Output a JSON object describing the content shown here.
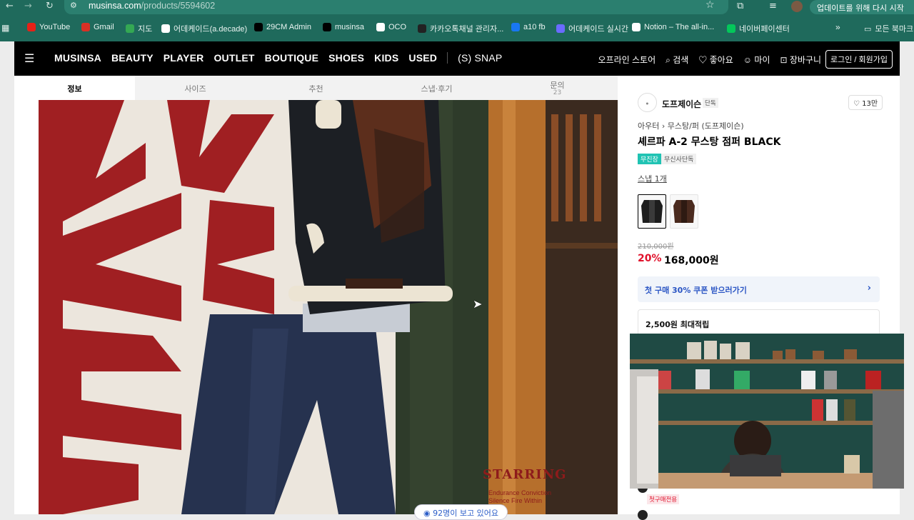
{
  "browser": {
    "url_host": "musinsa.com",
    "url_path": "/products/5594602",
    "update_label": "업데이트를 위해 다시 시작"
  },
  "bookmarks": [
    {
      "label": "YouTube",
      "icon": "youtube-icon",
      "color": "#e62117"
    },
    {
      "label": "Gmail",
      "icon": "gmail-icon",
      "color": "#d93025"
    },
    {
      "label": "지도",
      "icon": "maps-icon",
      "color": "#34a853"
    },
    {
      "label": "어데케이드(a.decade)",
      "icon": "globe-icon",
      "color": "#ffffff"
    },
    {
      "label": "29CM Admin",
      "icon": "29cm-icon",
      "color": "#000000"
    },
    {
      "label": "musinsa",
      "icon": "musinsa-icon",
      "color": "#000000"
    },
    {
      "label": "OCO",
      "icon": "globe-icon",
      "color": "#ffffff"
    },
    {
      "label": "카카오톡채널 관리자...",
      "icon": "kakao-icon",
      "color": "#222222"
    },
    {
      "label": "a10 fb",
      "icon": "facebook-icon",
      "color": "#1877f2"
    },
    {
      "label": "어데케이드 실시간",
      "icon": "chat-icon",
      "color": "#6b6bff"
    },
    {
      "label": "Notion – The all-in...",
      "icon": "notion-icon",
      "color": "#ffffff"
    },
    {
      "label": "네이버페이센터",
      "icon": "naverpay-icon",
      "color": "#03c75a"
    }
  ],
  "bookmarks_folder": "모든 북마크",
  "header": {
    "nav": [
      "MUSINSA",
      "BEAUTY",
      "PLAYER",
      "OUTLET",
      "BOUTIQUE",
      "SHOES",
      "KIDS",
      "USED"
    ],
    "snap": "(S) SNAP",
    "util": [
      "오프라인 스토어",
      "검색",
      "좋아요",
      "마이",
      "장바구니"
    ],
    "login": "로그인 / 회원가입"
  },
  "tabs": [
    {
      "label": "정보",
      "active": true
    },
    {
      "label": "사이즈"
    },
    {
      "label": "추천"
    },
    {
      "label": "스냅·후기"
    },
    {
      "label": "문의",
      "count": "23"
    }
  ],
  "image": {
    "starring": "STARRING",
    "starring_sub1": "Endurance Conviction",
    "starring_sub2": "Silence Fire Within",
    "viewers": "92명이 보고 있어요"
  },
  "product": {
    "brand": "도프제이슨",
    "brand_tag": "단독",
    "likes": "13만",
    "category": "아우터",
    "subcategory": "무스탕/퍼 (도프제이슨)",
    "title": "셰르파 A-2 무스탕 점퍼 BLACK",
    "badge_1": "무진장",
    "badge_2": "무신사단독",
    "snap_link": "스냅 1개",
    "original_price": "210,000원",
    "discount": "20%",
    "sale_price": "168,000원",
    "coupon": "첫 구매 30% 쿠폰 받으러가기",
    "points": "2,500원 최대적립",
    "bottom_tag": "첫구매전용"
  },
  "colors": {
    "chrome": "#1f6a5c",
    "sale_red": "#e0112b",
    "link_blue": "#2a55c4",
    "badge_teal": "#20c3b3"
  }
}
